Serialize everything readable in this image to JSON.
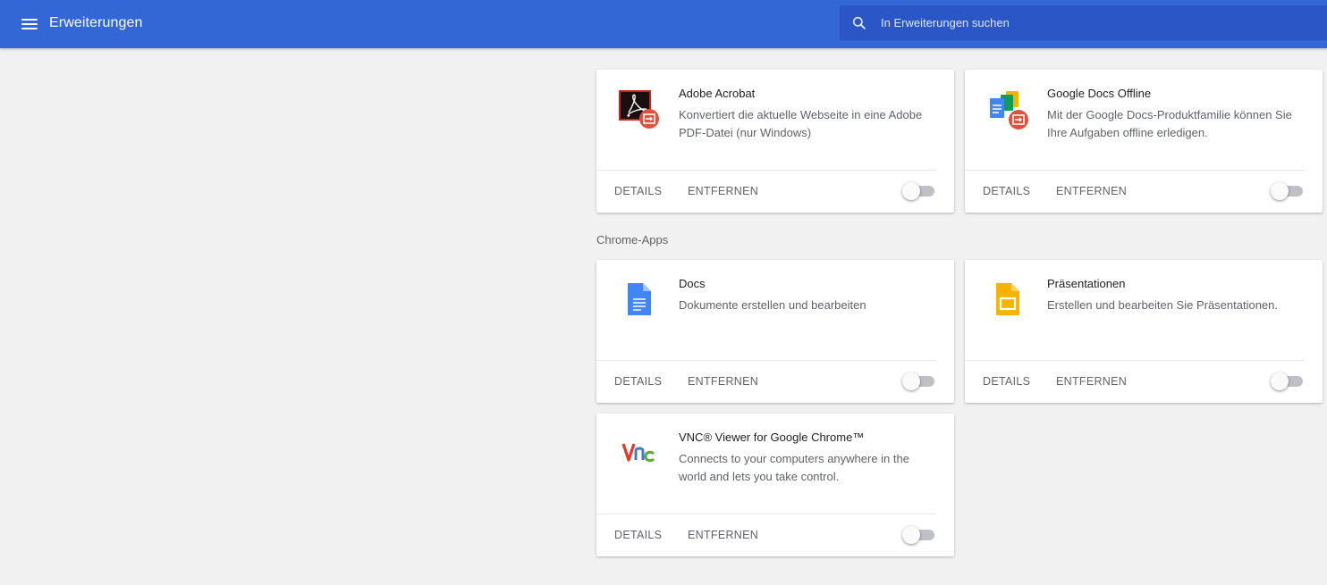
{
  "header": {
    "title": "Erweiterungen",
    "search_placeholder": "In Erweiterungen suchen"
  },
  "colors": {
    "toolbar": "#3367d6",
    "search_bg": "#2a56c6",
    "page_bg": "#f1f1f1"
  },
  "sections": {
    "chrome_apps_label": "Chrome-Apps"
  },
  "extensions": [
    {
      "name": "Adobe Acrobat",
      "description": "Konvertiert die aktuelle Webseite in eine Adobe PDF-Datei (nur Windows)",
      "icon": "adobe-acrobat-icon",
      "details_label": "DETAILS",
      "remove_label": "ENTFERNEN",
      "enabled": false
    },
    {
      "name": "Google Docs Offline",
      "description": "Mit der Google Docs-Produktfamilie können Sie Ihre Aufgaben offline erledigen.",
      "icon": "google-docs-offline-icon",
      "details_label": "DETAILS",
      "remove_label": "ENTFERNEN",
      "enabled": false
    }
  ],
  "apps": [
    {
      "name": "Docs",
      "description": "Dokumente erstellen und bearbeiten",
      "icon": "docs-icon",
      "details_label": "DETAILS",
      "remove_label": "ENTFERNEN",
      "enabled": false
    },
    {
      "name": "Präsentationen",
      "description": "Erstellen und bearbeiten Sie Präsentationen.",
      "icon": "slides-icon",
      "details_label": "DETAILS",
      "remove_label": "ENTFERNEN",
      "enabled": false
    },
    {
      "name": "VNC® Viewer for Google Chrome™",
      "description": "Connects to your computers anywhere in the world and lets you take control.",
      "icon": "vnc-viewer-icon",
      "details_label": "DETAILS",
      "remove_label": "ENTFERNEN",
      "enabled": false
    }
  ]
}
